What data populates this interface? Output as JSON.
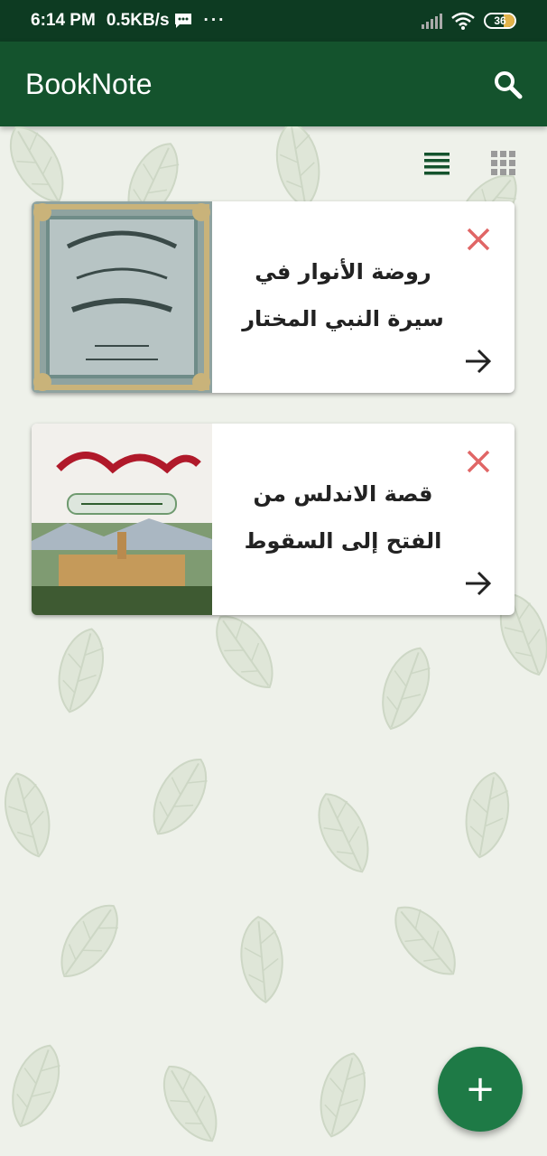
{
  "status_bar": {
    "time": "6:14 PM",
    "net_speed": "0.5KB/s",
    "more": "···",
    "battery": "36"
  },
  "app_bar": {
    "title": "BookNote",
    "search_icon": "search-icon"
  },
  "view_toggle": {
    "list_icon": "list-view-icon",
    "grid_icon": "grid-view-icon",
    "active": "list"
  },
  "books": [
    {
      "title_line1": "روضة الأنوار في",
      "title_line2": "سيرة النبي المختار",
      "cover_theme": "ornamental-green"
    },
    {
      "title_line1": "قصة الاندلس من",
      "title_line2": "الفتح إلى السقوط",
      "cover_theme": "landscape-red-calligraphy"
    }
  ],
  "fab": {
    "label": "+"
  },
  "colors": {
    "status_bar": "#0d3b22",
    "app_bar": "#14532d",
    "accent": "#1e7a46",
    "delete": "#e06666"
  }
}
